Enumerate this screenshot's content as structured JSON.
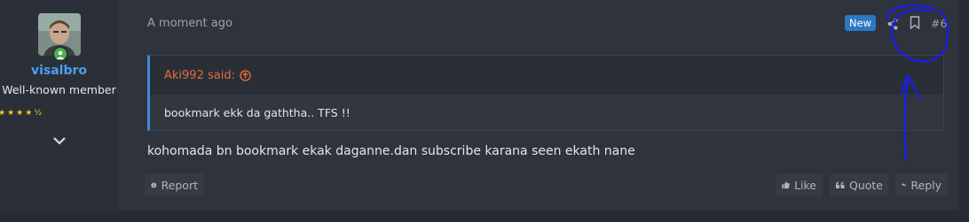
{
  "user": {
    "name": "visalbro",
    "title": "Well-known member",
    "stars": [
      "★",
      "★",
      "★",
      "★",
      "½"
    ]
  },
  "post": {
    "date": "A moment ago",
    "badge": "New",
    "number": "#6",
    "quote": {
      "author": "Aki992 said:",
      "text": "bookmark ekk da gaththa.. TFS !!"
    },
    "message": "kohomada bn bookmark ekak daganne.dan subscribe karana seen ekath nane"
  },
  "actions": {
    "report": "Report",
    "like": "Like",
    "quote": "Quote",
    "reply": "Reply"
  },
  "colors": {
    "accent": "#4a9ff5",
    "quote_author": "#e46b3a",
    "badge": "#2b78c5",
    "annotation": "#1a1aff"
  }
}
